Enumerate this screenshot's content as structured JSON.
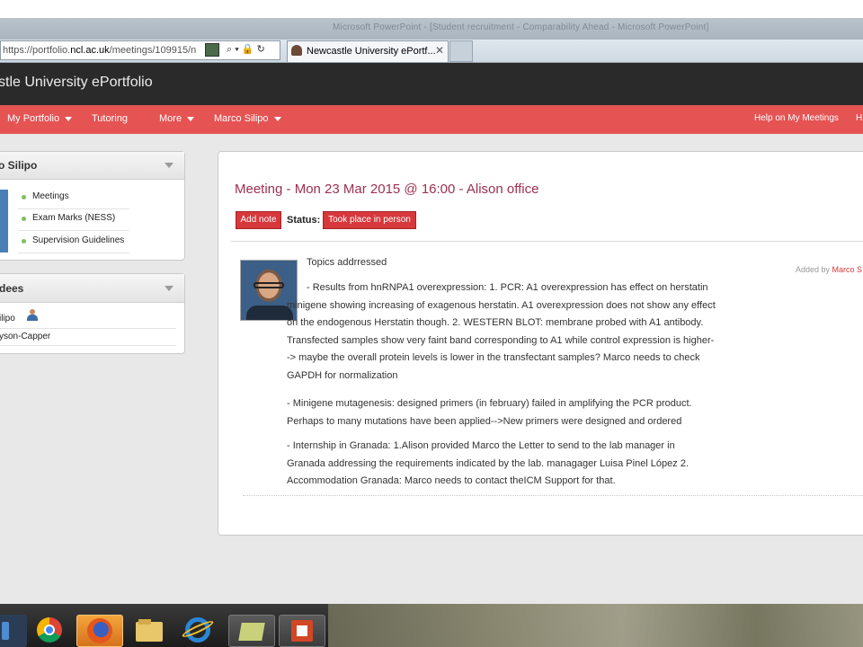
{
  "browser": {
    "window_title": "Microsoft PowerPoint - [Student recruitment - Comparability Ahead - Microsoft PowerPoint]",
    "address": {
      "prefix": "https://portfolio.",
      "domain": "ncl.ac.uk",
      "path": "/meetings/109915/n"
    },
    "address_icons": "⌕ ▾ 🔒 ↻",
    "tab_title": "Newcastle University ePortf...",
    "tab_close": "✕"
  },
  "app": {
    "title": "stle University ePortfolio"
  },
  "nav": {
    "items": [
      {
        "label": "My Portfolio",
        "dropdown": true
      },
      {
        "label": "Tutoring",
        "dropdown": false
      },
      {
        "label": "More",
        "dropdown": true
      },
      {
        "label": "Marco Silipo",
        "dropdown": true
      }
    ],
    "right": [
      {
        "label": "Help on My Meetings"
      },
      {
        "label": "H"
      }
    ]
  },
  "sidebar": {
    "profile_panel": {
      "title": "o Silipo",
      "links": [
        "Meetings",
        "Exam Marks (NESS)",
        "Supervision Guidelines"
      ]
    },
    "attendees_panel": {
      "title": "dees",
      "people": [
        "ilipo",
        "yson-Capper"
      ]
    }
  },
  "meeting": {
    "title": "Meeting - Mon 23 Mar 2015 @ 16:00 - Alison office",
    "add_note": "Add note",
    "status_label": "Status:",
    "status_value": "Took place in person",
    "note": {
      "heading": "Topics addrressed",
      "added_by_label": "Added by",
      "added_by_name": "Marco S",
      "paragraphs": [
        "- Results from hnRNPA1 overexpression: 1. PCR: A1 overexpression has effect on herstatin minigene showing increasing of exagenous herstatin. A1 overexpression does not show any effect on the endogenous Herstatin though. 2. WESTERN BLOT: membrane probed with A1 antibody. Transfected samples show very faint band corresponding to A1  while control expression is higher--> maybe the overall protein levels is lower in the transfectant samples? Marco needs to check GAPDH for normalization",
        "- Minigene mutagenesis: designed primers (in february) failed in amplifying the PCR product. Perhaps to many mutations have been applied-->New primers were designed and ordered",
        "- Internship in Granada: 1.Alison provided Marco the Letter to send to the  lab manager in Granada addressing the requirements indicated by the lab. managager Luisa Pinel López 2. Accommodation Granada: Marco needs to contact theICM Support for that."
      ]
    }
  },
  "colors": {
    "nav_red": "#e55353",
    "title_maroon": "#9d2f4f",
    "button_red": "#d6383c",
    "header_dark": "#2a2a2a"
  },
  "taskbar": {
    "apps": [
      {
        "icon": "windows-explorer-icon"
      },
      {
        "icon": "chrome-icon"
      },
      {
        "icon": "firefox-icon"
      },
      {
        "icon": "file-explorer-icon"
      },
      {
        "icon": "internet-explorer-icon"
      },
      {
        "icon": "folder-icon"
      },
      {
        "icon": "powerpoint-icon"
      }
    ]
  }
}
